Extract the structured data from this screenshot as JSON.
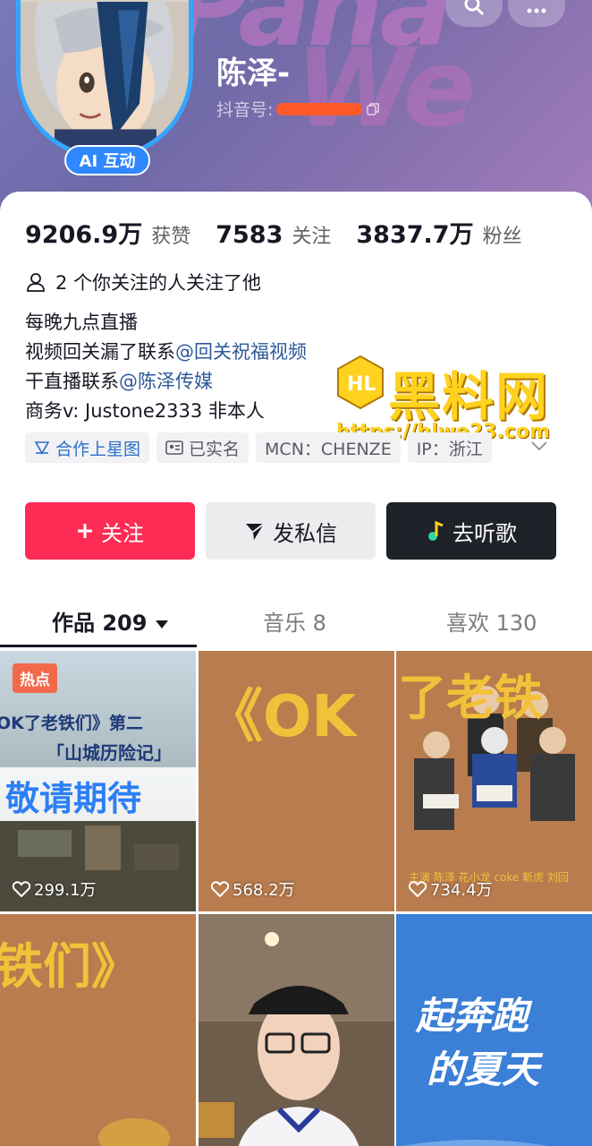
{
  "profile": {
    "username": "陈泽-",
    "douyin_id_label": "抖音号:",
    "ai_badge": "AI 互动"
  },
  "stats": [
    {
      "value": "9206.9万",
      "label": "获赞"
    },
    {
      "value": "7583",
      "label": "关注"
    },
    {
      "value": "3837.7万",
      "label": "粉丝"
    }
  ],
  "mutual": "2 个你关注的人关注了他",
  "bio": {
    "line1": "每晚九点直播",
    "line2_text": "视频回关漏了联系",
    "line2_mention": "@回关祝福视频",
    "line3_text": "干直播联系",
    "line3_mention": "@陈泽传媒",
    "line4": "商务v: Justone2333 非本人"
  },
  "tags": {
    "star": "合作上星图",
    "verified": "已实名",
    "mcn": "MCN：CHENZE",
    "ip": "IP：浙江"
  },
  "watermark": {
    "title": "黑料网",
    "url": "https://hlwe23.com"
  },
  "actions": {
    "follow": "关注",
    "message": "发私信",
    "music": "去听歌"
  },
  "tabs": {
    "works": "作品 209",
    "music": "音乐 8",
    "likes": "喜欢 130"
  },
  "videos": [
    {
      "likes": "299.1万",
      "badge": "热点",
      "line1": "OK了老铁们》第二",
      "line2": "「山城历险记」",
      "line3": "敬请期待"
    },
    {
      "likes": "568.2万",
      "line1": "《OK"
    },
    {
      "likes": "734.4万",
      "line1": "了老铁",
      "credits": "主演 陈泽 花小龙 coke 靳虎 刘回"
    },
    {
      "line1": "铁们》"
    },
    {},
    {
      "line1": "起奔跑",
      "line2": "的夏天"
    }
  ],
  "colors": {
    "follow": "#fe2c55",
    "mention": "#2d5a9a",
    "header": "#7a78b8",
    "avatar_ring": "#33a6ff",
    "watermark": "#ffd21f"
  }
}
